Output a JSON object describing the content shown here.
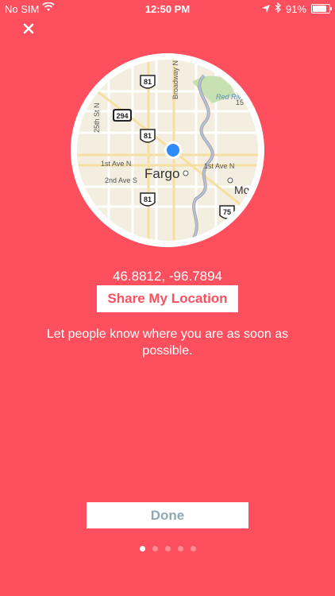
{
  "status_bar": {
    "carrier": "No SIM",
    "time": "12:50 PM",
    "battery": "91%",
    "battery_level": 0.91
  },
  "icons": {
    "close": "close-icon",
    "wifi": "wifi-icon",
    "location": "location-arrow-icon",
    "bluetooth": "bluetooth-icon",
    "battery": "battery-icon"
  },
  "map": {
    "city": "Fargo",
    "neighbor_city": "Moo",
    "river": "Red River",
    "streets": [
      "1st Ave N",
      "2nd Ave S",
      "Broadway N",
      "15",
      "25th St N"
    ],
    "highway_shields": [
      "81",
      "294",
      "81",
      "81",
      "75"
    ]
  },
  "location": {
    "coordinates": "46.8812, -96.7894"
  },
  "share_button": {
    "label": "Share My Location"
  },
  "description": "Let people know where you are as soon as possible.",
  "done_button": {
    "label": "Done"
  },
  "page_indicator": {
    "total": 5,
    "current": 1
  },
  "colors": {
    "background": "#FE4F5E",
    "accent": "#FE4F5E",
    "done_text": "#8FA9B4",
    "user_dot": "#2F8CF6"
  }
}
